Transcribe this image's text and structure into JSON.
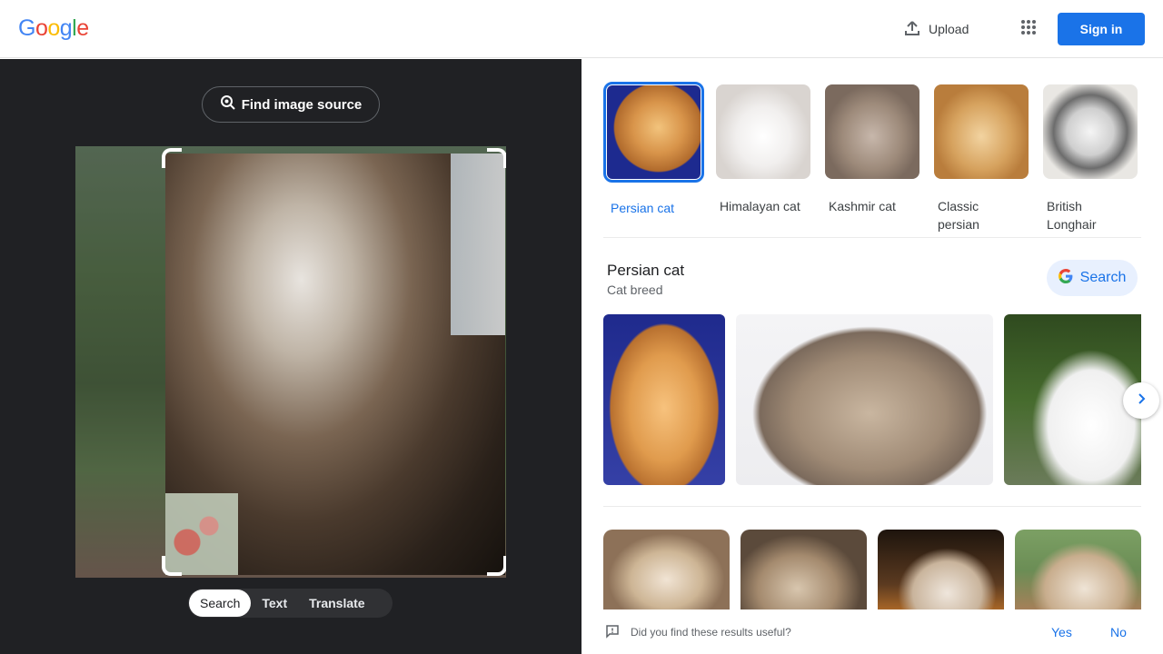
{
  "header": {
    "logo_letters": [
      {
        "char": "G",
        "color": "#4285F4"
      },
      {
        "char": "o",
        "color": "#EA4335"
      },
      {
        "char": "o",
        "color": "#FBBC05"
      },
      {
        "char": "g",
        "color": "#4285F4"
      },
      {
        "char": "l",
        "color": "#34A853"
      },
      {
        "char": "e",
        "color": "#EA4335"
      }
    ],
    "upload_label": "Upload",
    "upload_icon": "upload-icon",
    "apps_icon": "apps-grid-icon",
    "signin_label": "Sign in",
    "signin_color": "#1a73e8"
  },
  "left": {
    "find_source_label": "Find image source",
    "find_source_icon": "lens-search-icon",
    "modes": [
      "Search",
      "Text",
      "Translate"
    ],
    "active_mode": "Search"
  },
  "right": {
    "related": [
      {
        "label": "Persian cat",
        "active": true
      },
      {
        "label": "Himalayan cat",
        "active": false
      },
      {
        "label": "Kashmir cat",
        "active": false
      },
      {
        "label": "Classic persian",
        "active": false
      },
      {
        "label": "British Longhair",
        "active": false
      }
    ],
    "entity": {
      "title": "Persian cat",
      "subtitle": "Cat breed",
      "search_label": "Search"
    },
    "feedback": {
      "question": "Did you find these results useful?",
      "yes": "Yes",
      "no": "No"
    }
  },
  "colors": {
    "accent": "#1a73e8",
    "dark_panel": "#202124"
  }
}
